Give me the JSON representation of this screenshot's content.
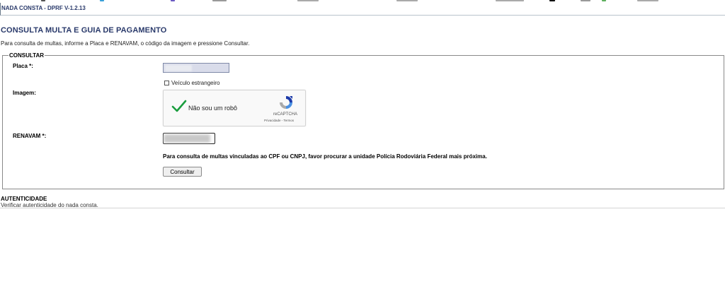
{
  "header": {
    "title": "NADA CONSTA - DPRF V-1.2.13"
  },
  "main": {
    "page_title": "CONSULTA MULTA E GUIA DE PAGAMENTO",
    "instructions": "Para consulta de multas, informe a Placa e RENAVAM, o código da imagem e pressione Consultar."
  },
  "form": {
    "legend": "CONSULTAR",
    "placa_label": "Placa *:",
    "foreign_vehicle_label": "Veículo estrangeiro",
    "imagem_label": "Imagem:",
    "renavam_label": "RENAVAM *:",
    "notice": "Para consulta de multas vinculadas ao CPF ou CNPJ, favor procurar a unidade Polícia Rodoviária Federal mais próxima.",
    "submit_label": "Consultar"
  },
  "captcha": {
    "label": "Não sou um robô",
    "brand": "reCAPTCHA",
    "links": "Privacidade - Termos",
    "checked": true,
    "check_color": "#1a9d3e"
  },
  "authenticity": {
    "title": "AUTENTICIDADE",
    "description": "Verificar autenticidade do nada consta."
  },
  "colors": {
    "title": "#2a3a6b",
    "input_bg": "#d9dcea",
    "border": "#8a8a8a"
  }
}
